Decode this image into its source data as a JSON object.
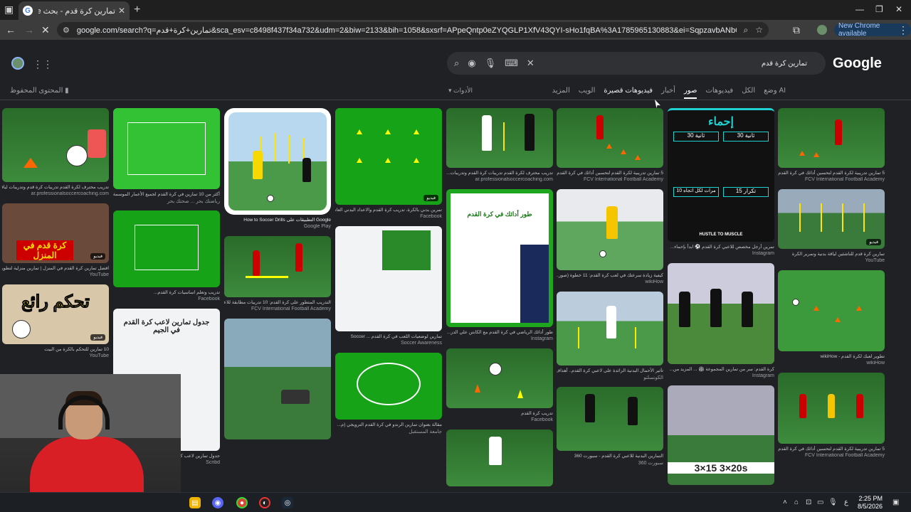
{
  "browser": {
    "tab_title": "تمارين كرة قدم - بحث Google",
    "url": "google.com/search?q=تمارين+كرة+قدم&sca_esv=c8498f437f34a732&udm=2&biw=2133&bih=1058&sxsrf=APpeQntp0eZYQGLP1XfV43QYI-sHo1fqBA%3A1785965130883&ei=SqpzavbANbGLxc8PvbjG6Ak&ved=0ahUKEwj2jdTJ...",
    "new_chrome_label": "New Chrome available"
  },
  "google": {
    "logo": "Google",
    "query": "تمارين كرة قدم",
    "nav_tabs": [
      "وضع AI",
      "الكل",
      "فيديوهات",
      "صور",
      "أخبار",
      "فيديوهات قصيرة",
      "الويب",
      "المزيد"
    ],
    "active_tab": "صور",
    "tools_label": "الأدوات",
    "saved_label": "المحتوى المحفوظ"
  },
  "results": {
    "col1": [
      {
        "caption": "تدريب محترف لكرة القدم تدريبات كرة قدم وتدريبات لياقة...",
        "source": "ar.professionalsoccercoaching.com"
      },
      {
        "caption": "افضل تمارين كرة القدم في المنزل | تمارين منزلية لتطوير...",
        "source": "YouTube",
        "overlay": "كرة قدم في المنزل"
      },
      {
        "caption": "10 تمارين للتحكم بالكرة من البيت",
        "source": "YouTube",
        "overlay": "تحكم رائع"
      }
    ],
    "col2": [
      {
        "caption": "أكثر من 10 تمارين في كرة القدم لجميع الأعمار الموسمة...",
        "source": "رياضتك بحر ... صحتك بحر"
      },
      {
        "caption": "تدريب وتعلم اساسيات كرة القدم...",
        "source": "Facebook"
      },
      {
        "caption": "جدول تمارين لاعب كرة القدم في الجيم",
        "source": "Scribd",
        "overlay": "جدول تمارين لاعب كرة القدم في الجيم"
      }
    ],
    "col3": [
      {
        "caption": "Google التطبيقات على How to Soccer Drills",
        "source": "Google Play"
      },
      {
        "caption": "التدريب المتطور على كرة القدم: 10 تدريبات مطابقة للاعب وخطط",
        "source": "FCV International Football Academy"
      },
      {
        "caption": "",
        "source": ""
      }
    ],
    "col4": [
      {
        "caption": "تمرين بدني بالكرة، تدريب كرة القدم والاعداد البدني العام...",
        "source": "Facebook"
      },
      {
        "caption": "تمارين لوضعيات اللعب في كرة القدم ... Soccer",
        "source": "Soccer Awareness"
      },
      {
        "caption": "مقالة بعنوان تمارين الرندو في كرة القدم الترويجي (م...",
        "source": "جامعة المستقبل"
      }
    ],
    "col5": [
      {
        "caption": "تدريب محترف لكرة القدم تدريبات كرة القدم وتدريبات...",
        "source": "ar.professionalsoccercoaching.com"
      },
      {
        "caption": "طور أدائك الرياضي في كرة القدم مع الكابتن علي الدر...",
        "source": "Instagram",
        "overlay": "طور أدائك في كرة القدم"
      },
      {
        "caption": "تدريب كرة القدم",
        "source": "Facebook"
      }
    ],
    "col6": [
      {
        "caption": "5 تمارين تدريبية لكرة القدم لتحسين أدائك في كرة القدم",
        "source": "FCV International Football Academy"
      },
      {
        "caption": "كيفية زيادة سرعتك في لعب كرة القدم: 11 خطوة (صور...",
        "source": "wikiHow"
      },
      {
        "caption": "تأثير الأحمال البدنية الزائدة على لاعبي كرة القدم.. أهداف",
        "source": "الكونسلتو"
      },
      {
        "caption": "التمارين البدنية للاعبي كرة القدم - سبورت 360",
        "source": "سبورت 360"
      }
    ],
    "col7": [
      {
        "caption": "تمرين أرجل مخصص للاعبي كرة القدم ⚽ ابدأ بإحماء...",
        "source": "Instagram",
        "overlay": "إحماء"
      },
      {
        "caption": "كرة القدم: سر من تمارين المجموعة 🏟 ... المزيد من...",
        "source": "Instagram"
      },
      {
        "caption": "",
        "source": "",
        "overlay": "3×15  3×20s"
      }
    ],
    "col8": [
      {
        "caption": "5 تمارين تدريبية لكرة القدم لتحسين أدائك في كرة القدم",
        "source": "FCV International Football Academy"
      },
      {
        "caption": "تمارين كرة قدم للناشئين لياقة بدنية وتمرير الكرة",
        "source": "YouTube"
      },
      {
        "caption": "تطوير لعبك لكرة القدم - wikiHow",
        "source": "wikiHow"
      },
      {
        "caption": "5 تمارين تدريبية لكرة القدم لتحسين أدائك في كرة القدم",
        "source": "FCV International Football Academy"
      }
    ],
    "warmup": {
      "title": "إحماء",
      "cells": [
        "30 ثانية",
        "30 ثانية",
        "10 مرات لكل اتجاه",
        "15 تكرار"
      ],
      "footer": "HUSTLE TO MUSCLE"
    },
    "badge": "فيديو"
  },
  "taskbar": {
    "time": "2:25 PM",
    "date": "8/5/2026",
    "lang": "ع"
  }
}
